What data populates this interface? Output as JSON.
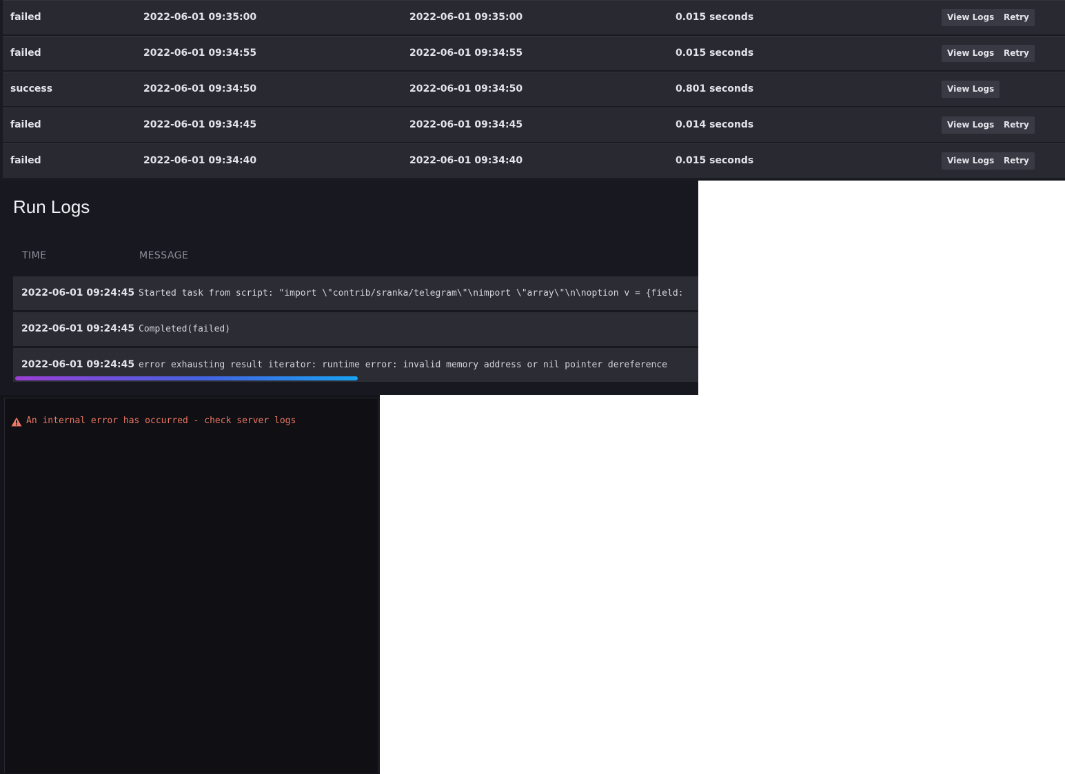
{
  "runs": [
    {
      "status": "failed",
      "started": "2022-06-01 09:35:00",
      "finished": "2022-06-01 09:35:00",
      "duration": "0.015 seconds",
      "actions": [
        "View Logs",
        "Retry"
      ]
    },
    {
      "status": "failed",
      "started": "2022-06-01 09:34:55",
      "finished": "2022-06-01 09:34:55",
      "duration": "0.015 seconds",
      "actions": [
        "View Logs",
        "Retry"
      ]
    },
    {
      "status": "success",
      "started": "2022-06-01 09:34:50",
      "finished": "2022-06-01 09:34:50",
      "duration": "0.801 seconds",
      "actions": [
        "View Logs"
      ]
    },
    {
      "status": "failed",
      "started": "2022-06-01 09:34:45",
      "finished": "2022-06-01 09:34:45",
      "duration": "0.014 seconds",
      "actions": [
        "View Logs",
        "Retry"
      ]
    },
    {
      "status": "failed",
      "started": "2022-06-01 09:34:40",
      "finished": "2022-06-01 09:34:40",
      "duration": "0.015 seconds",
      "actions": [
        "View Logs",
        "Retry"
      ]
    }
  ],
  "run_logs": {
    "title": "Run Logs",
    "columns": {
      "time": "TIME",
      "message": "MESSAGE"
    },
    "entries": [
      {
        "time": "2022-06-01 09:24:45",
        "message": "Started task from script: \"import \\\"contrib/sranka/telegram\\\"\\nimport \\\"array\\\"\\n\\noption v = {field:"
      },
      {
        "time": "2022-06-01 09:24:45",
        "message": "Completed(failed)"
      },
      {
        "time": "2022-06-01 09:24:45",
        "message": "error exhausting result iterator: runtime error: invalid memory address or nil pointer dereference"
      }
    ]
  },
  "error": {
    "icon": "warning-icon",
    "message": "An internal error has occurred - check server logs",
    "color": "#ef7864"
  },
  "colors": {
    "row_bg": "#292a31",
    "panel_bg": "#181920",
    "button_bg": "#393a43",
    "scrollbar_gradient": [
      "#9b3fd6",
      "#19a2f2"
    ]
  }
}
